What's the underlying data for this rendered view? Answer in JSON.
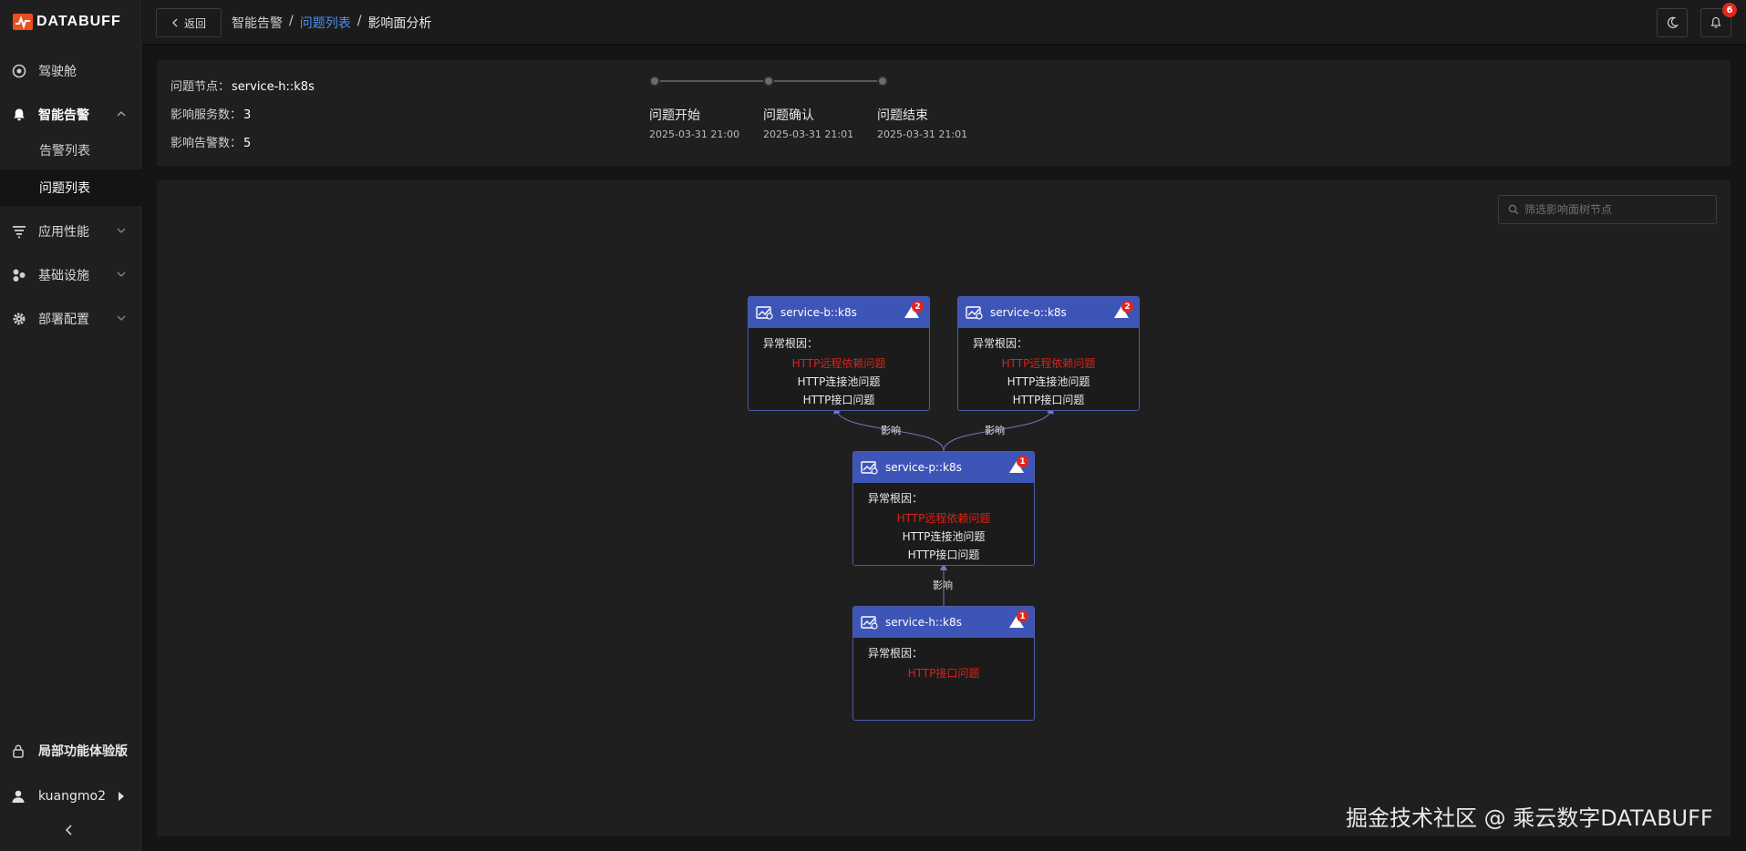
{
  "app": {
    "logo_text": "DATABUFF"
  },
  "sidebar": {
    "items": [
      {
        "label": "驾驶舱"
      },
      {
        "label": "智能告警"
      },
      {
        "label": "应用性能"
      },
      {
        "label": "基础设施"
      },
      {
        "label": "部署配置"
      }
    ],
    "sub_items": [
      {
        "label": "告警列表"
      },
      {
        "label": "问题列表"
      }
    ],
    "trial_label": "局部功能体验版",
    "user": "kuangmo2"
  },
  "topbar": {
    "back_label": "返回",
    "breadcrumb": [
      "智能告警",
      "问题列表",
      "影响面分析"
    ],
    "notification_count": "6"
  },
  "info": {
    "problem_node_label": "问题节点：",
    "problem_node": "service-h::k8s",
    "affected_services_label": "影响服务数：",
    "affected_services": "3",
    "affected_alerts_label": "影响告警数：",
    "affected_alerts": "5"
  },
  "timeline": [
    {
      "label": "问题开始",
      "time": "2025-03-31 21:00"
    },
    {
      "label": "问题确认",
      "time": "2025-03-31 21:01"
    },
    {
      "label": "问题结束",
      "time": "2025-03-31 21:01"
    }
  ],
  "graph": {
    "search_placeholder": "筛选影响面树节点",
    "root_cause_label": "异常根因：",
    "edge_label": "影响",
    "nodes": [
      {
        "name": "service-b::k8s",
        "alerts": "2",
        "causes": [
          "HTTP远程依赖问题",
          "HTTP连接池问题",
          "HTTP接口问题"
        ]
      },
      {
        "name": "service-o::k8s",
        "alerts": "2",
        "causes": [
          "HTTP远程依赖问题",
          "HTTP连接池问题",
          "HTTP接口问题"
        ]
      },
      {
        "name": "service-p::k8s",
        "alerts": "1",
        "causes": [
          "HTTP远程依赖问题",
          "HTTP连接池问题",
          "HTTP接口问题"
        ]
      },
      {
        "name": "service-h::k8s",
        "alerts": "1",
        "causes": [
          "HTTP接口问题"
        ]
      }
    ]
  },
  "watermark": "掘金技术社区 @ 乘云数字DATABUFF",
  "colors": {
    "accent": "#3e55b8",
    "link": "#4c8ef0",
    "error": "#d9231a",
    "badge": "#e0281f"
  }
}
